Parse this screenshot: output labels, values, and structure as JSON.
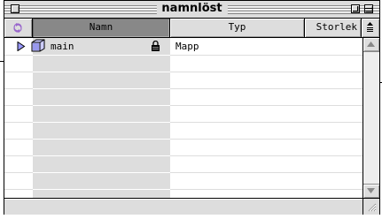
{
  "window": {
    "title": "namnlöst"
  },
  "columns": {
    "name": "Namn",
    "type": "Typ",
    "size": "Storlek"
  },
  "rows": [
    {
      "name": "main",
      "type": "Mapp",
      "locked": true,
      "icon": "folder-icon"
    }
  ],
  "colors": {
    "window_bg": "#dddddd",
    "selected_column": "#888888",
    "list_bg": "#ffffff",
    "sort_icon": "#9966cc"
  }
}
